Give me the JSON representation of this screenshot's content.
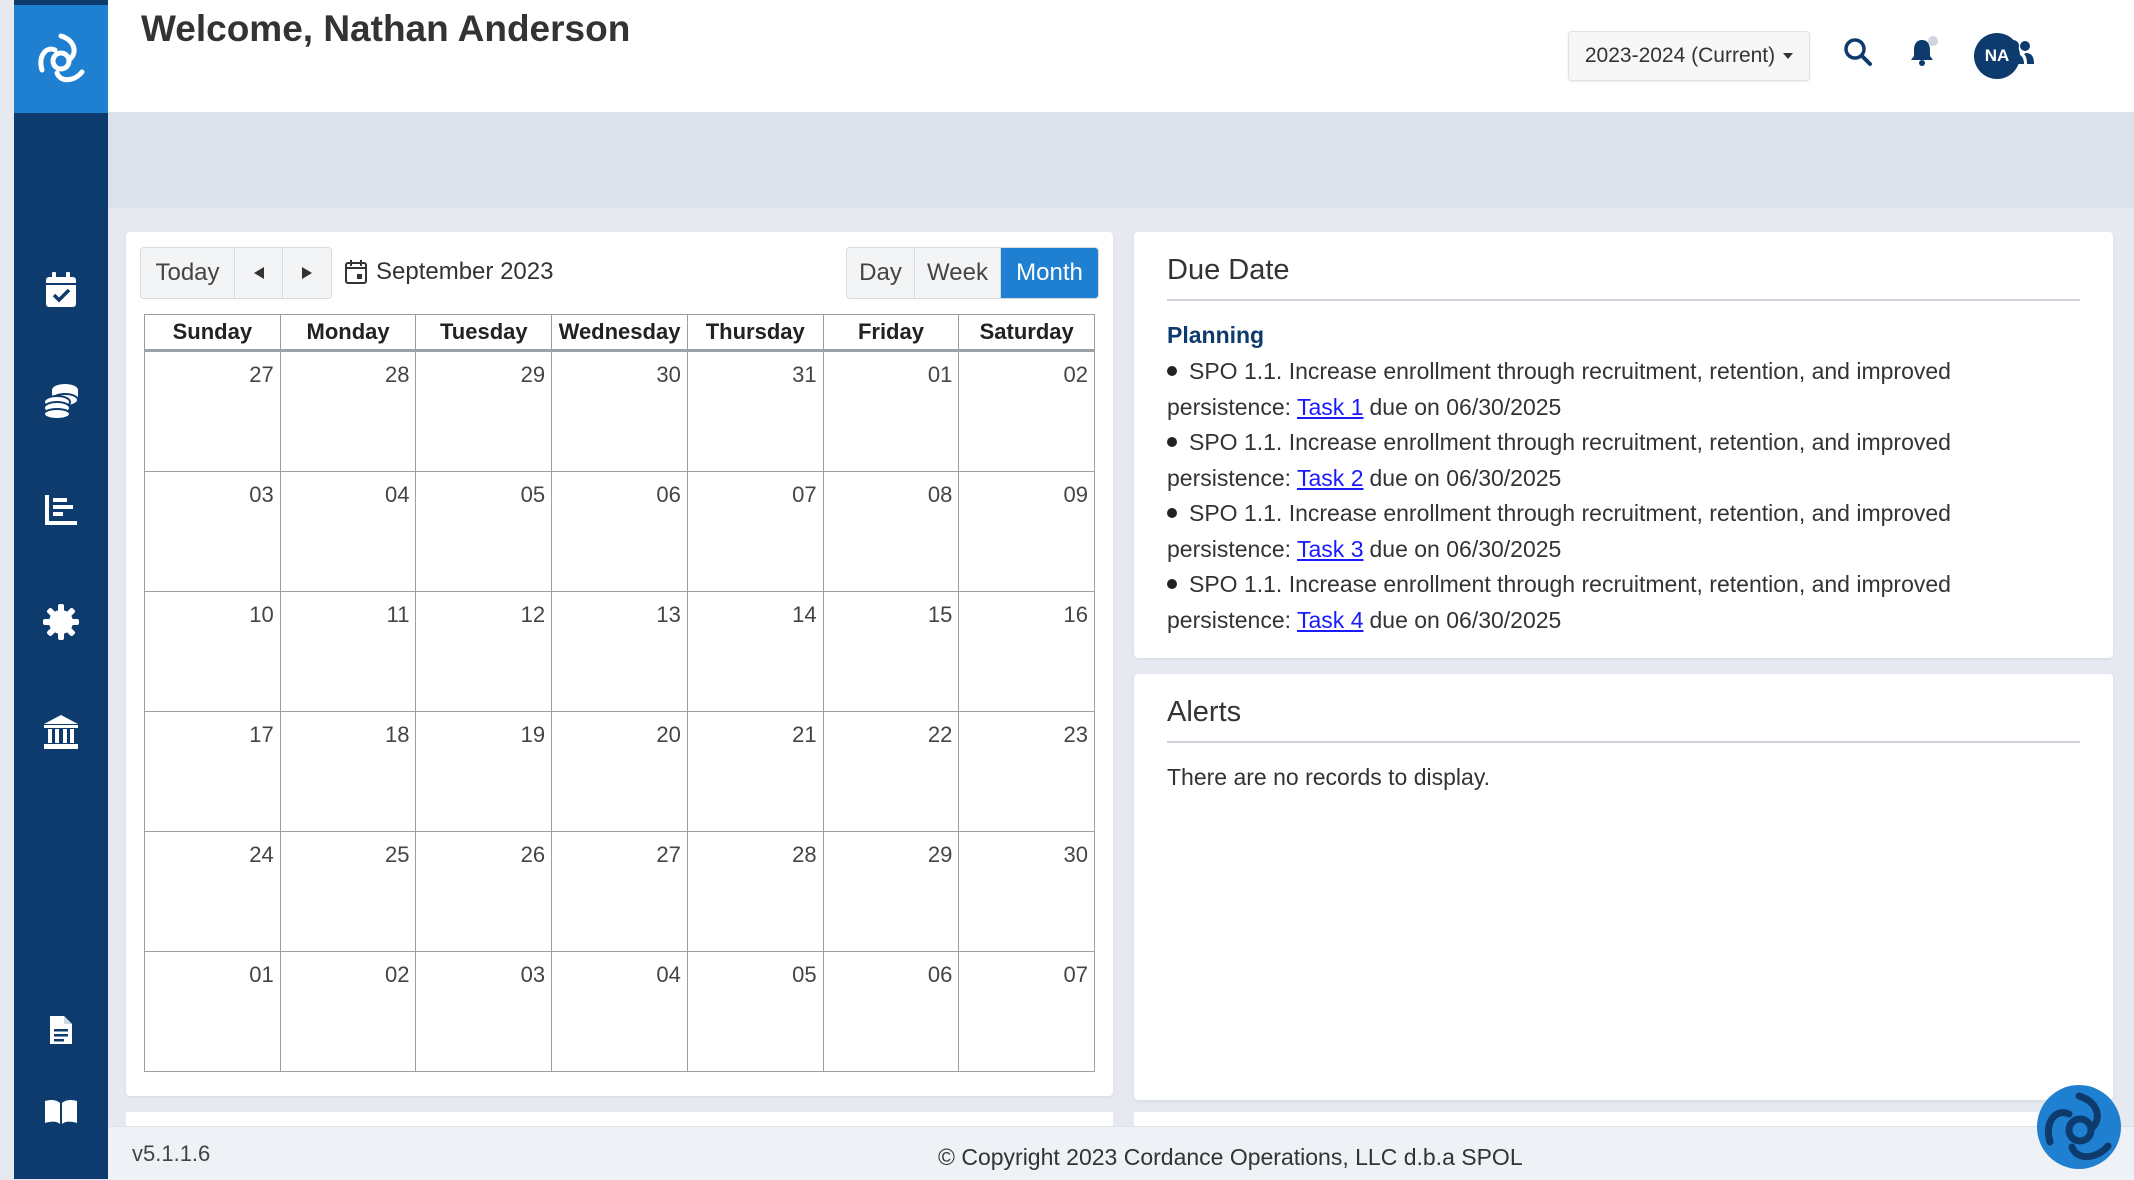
{
  "header": {
    "welcome": "Welcome, Nathan Anderson",
    "year_selector": "2023-2024 (Current)",
    "avatar_initials": "NA"
  },
  "sidebar": {
    "items": [
      {
        "icon": "calendar-check-icon"
      },
      {
        "icon": "coins-icon"
      },
      {
        "icon": "chart-bar-icon"
      },
      {
        "icon": "gear-icon"
      },
      {
        "icon": "institution-icon"
      },
      {
        "icon": "document-icon"
      },
      {
        "icon": "book-icon"
      }
    ]
  },
  "calendar": {
    "today_label": "Today",
    "month_label": "September 2023",
    "views": {
      "day": "Day",
      "week": "Week",
      "month": "Month"
    },
    "active_view": "Month",
    "weekdays": [
      "Sunday",
      "Monday",
      "Tuesday",
      "Wednesday",
      "Thursday",
      "Friday",
      "Saturday"
    ],
    "weeks": [
      [
        "27",
        "28",
        "29",
        "30",
        "31",
        "01",
        "02"
      ],
      [
        "03",
        "04",
        "05",
        "06",
        "07",
        "08",
        "09"
      ],
      [
        "10",
        "11",
        "12",
        "13",
        "14",
        "15",
        "16"
      ],
      [
        "17",
        "18",
        "19",
        "20",
        "21",
        "22",
        "23"
      ],
      [
        "24",
        "25",
        "26",
        "27",
        "28",
        "29",
        "30"
      ],
      [
        "01",
        "02",
        "03",
        "04",
        "05",
        "06",
        "07"
      ]
    ]
  },
  "due_date": {
    "title": "Due Date",
    "section": "Planning",
    "items": [
      {
        "text": "SPO 1.1. Increase enrollment through recruitment, retention, and improved persistence:",
        "task": "Task 1",
        "due": "due on 06/30/2025"
      },
      {
        "text": "SPO 1.1. Increase enrollment through recruitment, retention, and improved persistence:",
        "task": "Task 2",
        "due": "due on 06/30/2025"
      },
      {
        "text": "SPO 1.1. Increase enrollment through recruitment, retention, and improved persistence:",
        "task": "Task 3",
        "due": "due on 06/30/2025"
      },
      {
        "text": "SPO 1.1. Increase enrollment through recruitment, retention, and improved persistence:",
        "task": "Task 4",
        "due": "due on 06/30/2025"
      }
    ]
  },
  "alerts": {
    "title": "Alerts",
    "empty_text": "There are no records to display."
  },
  "footer": {
    "version": "v5.1.1.6",
    "copyright": "© Copyright 2023 Cordance Operations, LLC d.b.a SPOL"
  },
  "colors": {
    "sidebar": "#0e3b6d",
    "accent": "#1f7fd0",
    "link": "#1a1aff"
  }
}
